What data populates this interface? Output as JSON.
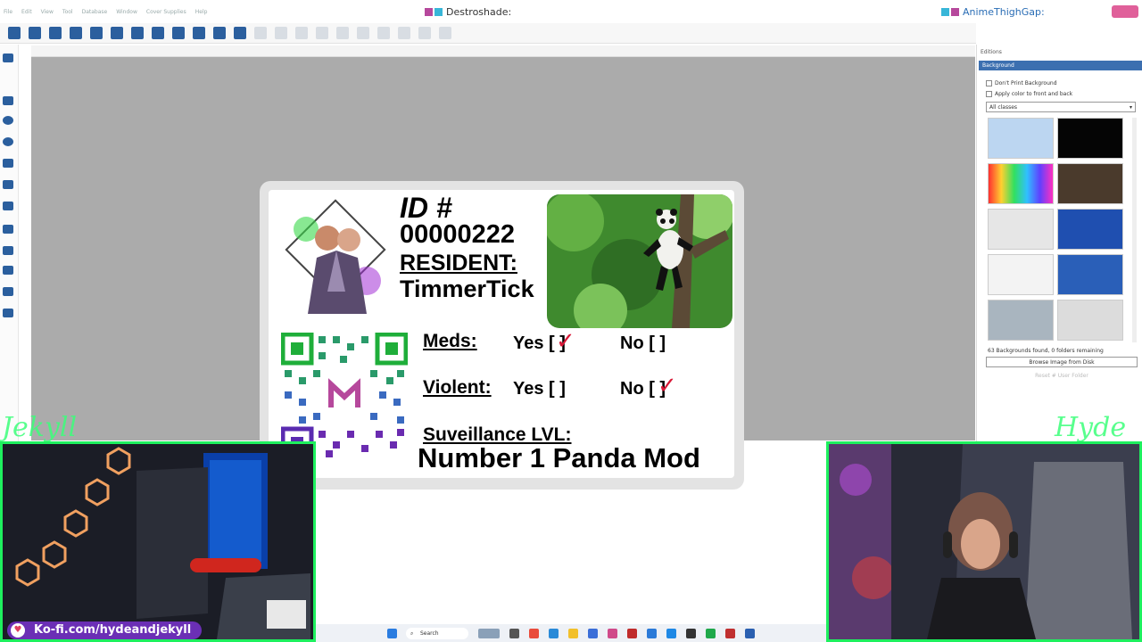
{
  "window": {
    "app_title": "Destroshade",
    "title_suffix": ":",
    "right_title": "AnimeThighGap",
    "right_title_suffix": ":",
    "menu": [
      "File",
      "Edit",
      "View",
      "Tool",
      "Database",
      "Window",
      "Cover Supplies",
      "Help"
    ]
  },
  "side_panel": {
    "header": "Editions",
    "section": "Background",
    "options": [
      "Don't Print Background",
      "Apply color to front and back"
    ],
    "class_select": "All classes",
    "status": "63 Backgrounds found, 0 folders remaining",
    "browse_button": "Browse Image from Disk",
    "reset_button": "Reset # User Folder"
  },
  "badge": {
    "id_label": "ID #",
    "id_number": "00000222",
    "resident_label": "RESIDENT:",
    "resident_name": "TimmerTick",
    "meds_label": "Meds:",
    "violent_label": "Violent:",
    "meds_yes": "Yes [ ]",
    "meds_no": "No [ ]",
    "violent_yes": "Yes [ ]",
    "violent_no": "No [ ]",
    "check_mark": "✓",
    "surveillance_label": "Suveillance LVL:",
    "surveillance_value": "Number 1 Panda Mod"
  },
  "overlay": {
    "left_name": "Jekyll",
    "right_name": "Hyde",
    "kofi": "Ko-fi.com/hydeandjekyll",
    "kofi_icon": "heart-icon"
  },
  "taskbar": {
    "search": "Search"
  },
  "colors": {
    "accent": "#2b5f9e",
    "webcam_border": "#1ef05e",
    "check": "#d81836",
    "kofi": "#6b2fb5"
  }
}
